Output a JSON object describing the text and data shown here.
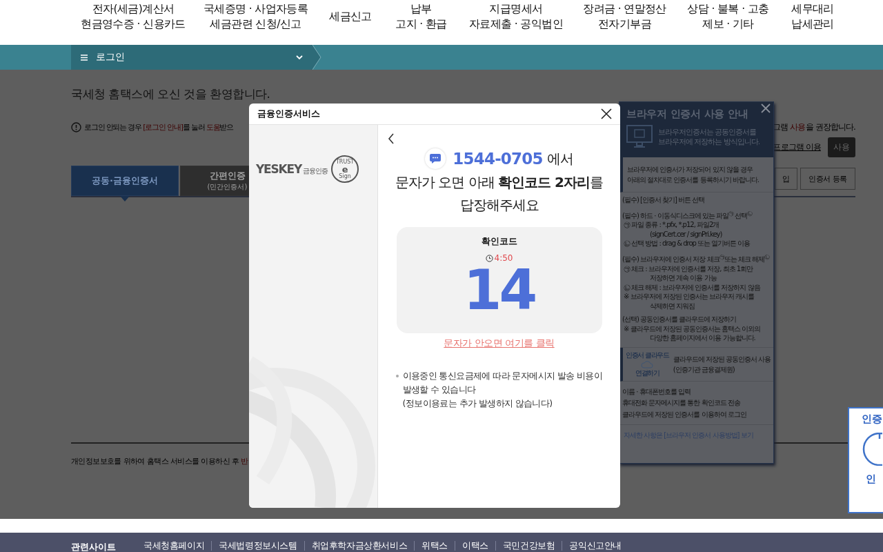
{
  "top_nav": [
    {
      "lines": [
        "전자(세금)계산서",
        "현금영수증 · 신용카드"
      ]
    },
    {
      "lines": [
        "국세증명 · 사업자등록",
        "세금관련 신청/신고"
      ]
    },
    {
      "lines": [
        "세금신고"
      ]
    },
    {
      "lines": [
        "납부",
        "고지 · 환급"
      ]
    },
    {
      "lines": [
        "지급명세서",
        "자료제출 · 공익법인"
      ]
    },
    {
      "lines": [
        "장려금 · 연말정산",
        "전자기부금"
      ]
    },
    {
      "lines": [
        "상담 · 불복 · 고충",
        "제보 · 기타"
      ]
    },
    {
      "lines": [
        "세무대리",
        "납세관리"
      ]
    }
  ],
  "menu_bar": {
    "label": "로그인"
  },
  "page": {
    "welcome": "국세청 홈택스에 오신 것을 환영합니다.",
    "notice": [
      {
        "text": "로그인 안되는 경우 ",
        "highlight": false
      },
      {
        "text": "[로그인 안내]",
        "highlight": true
      },
      {
        "text": "를 눌러 ",
        "highlight": false
      },
      {
        "text": "도움",
        "highlight": true
      },
      {
        "text": "받으",
        "highlight": false
      }
    ],
    "right_notice": [
      {
        "text": "그램 ",
        "highlight": false
      },
      {
        "text": "사용",
        "highlight": true
      },
      {
        "text": "을 권장합니다.",
        "highlight": false
      }
    ],
    "program_label": "프로그램 이용",
    "program_button": "사용",
    "tabs": [
      {
        "label": "공동·금융인증서",
        "selected": true
      },
      {
        "label": "간편인증",
        "sublabel": "(민간인증서)",
        "selected": false
      }
    ],
    "right_buttons": [
      "입",
      "인증서 등록"
    ],
    "privacy_note": [
      {
        "text": "개인정보보호를 위하여 홈택스 서비스를 이용하신 후 ",
        "highlight": false
      },
      {
        "text": "반",
        "highlight": true
      }
    ]
  },
  "modal": {
    "title": "금융인증서비스",
    "logo": {
      "name": "YESKEY",
      "sub": "금융인증",
      "badge_top": "TRUST",
      "badge_letter": "e",
      "badge_bottom": "Sign"
    },
    "phone": "1544-0705",
    "phone_suffix": "에서",
    "message_lines": [
      "문자가 오면 아래 **확인코드 2자리**를",
      "답장해주세요"
    ],
    "code_label": "확인코드",
    "timer": "4:50",
    "code": "14",
    "resend_link": "문자가 안오면 여기를 클릭",
    "notes": [
      "이용중인 통신요금제에 따라 문자메시지 발송 비용이 발생할 수 있습니다",
      "(정보이용료는 추가 발생하지 않습니다)"
    ]
  },
  "cert_panel": {
    "title": "브라우저 인증서 사용 안내",
    "intro": [
      "브라우저인증서는 공동인증서를",
      "브라우저에 저장하는 방식입니다."
    ],
    "notice": [
      "브라우저에 인증서가 저장되어 있지 않을 경우",
      "아래의 절차대로 인증서를 등록하시기 바랍니다."
    ],
    "sections": [
      [
        {
          "kind": "step",
          "text": "(필수) [인증서 찾기] 버튼 선택"
        }
      ],
      [
        {
          "kind": "step",
          "text": "(필수) 하드 · 이동식디스크에 있는 파일$^{㉠}$ 선택$^{㉡}$"
        },
        {
          "kind": "sub",
          "text": "㉠ 파일 종류 : *.pfx, *.p12, 파일2개"
        },
        {
          "kind": "cont",
          "text": "(signCert.cer / signPri.key)"
        },
        {
          "kind": "sub",
          "text": "㉡ 선택 방법 : drag & drop 또는 열기버튼 이용"
        }
      ],
      [
        {
          "kind": "step",
          "text": "(필수) 브라우저에 인증서 저장 체크$^{㉠}$또는 체크 해제$^{㉡}$"
        },
        {
          "kind": "sub",
          "text": "㉠ 체크 : 브라우저에 인증서를 저장, 최초 1회만"
        },
        {
          "kind": "cont",
          "text": "저장하면 계속 이용 가능"
        },
        {
          "kind": "sub",
          "text": "㉡ 체크 해제 : 브라우저에 인증서를 저장하지 않음"
        },
        {
          "kind": "sub",
          "text": "※ 브라우저에 저장된 인증서는 브라우저 캐시를"
        },
        {
          "kind": "cont",
          "text": "삭제하면 지워짐"
        }
      ],
      [
        {
          "kind": "step",
          "text": "(선택) 공동인증서를 클라우드에 저장하기"
        },
        {
          "kind": "sub",
          "text": "※ 클라우드에 저장된 공동인증서는 홈택스 이외의"
        },
        {
          "kind": "cont",
          "text": "다양한 홈페이지에서 이용 가능합니다."
        }
      ]
    ],
    "cloud": {
      "badge_top": "인증서 클라우드",
      "badge_bottom": "연결하기",
      "lines": [
        "클라우드에 저장된 공동인증서 사용",
        "(인증기관 금융결제원)"
      ]
    },
    "cloud_steps": [
      "이름 · 휴대폰번호를 입력",
      "휴대전화 문자메시지를 통한 확인코드 전송",
      "클라우드에 저장된 인증서를 이용하여 로그인"
    ],
    "link": "자세한 사항은 [브라우저 인증서 사용방법] 보기"
  },
  "side_widget": {
    "title": "인증",
    "caption": "인"
  },
  "footer": {
    "title": "관련사이트",
    "links": [
      "국세청홈페이지",
      "국세법령정보시스템",
      "취업후학자금상환서비스",
      "위택스",
      "이택스",
      "국민건강보험",
      "공익신고안내"
    ]
  }
}
